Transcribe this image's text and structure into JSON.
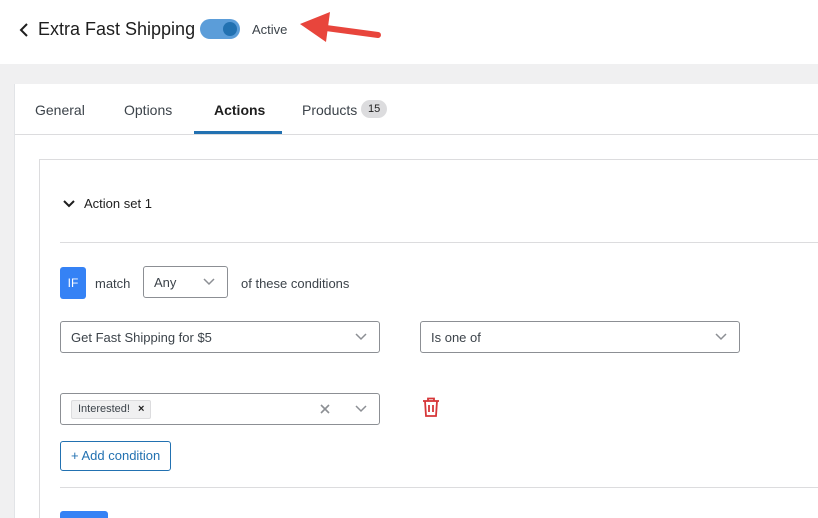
{
  "header": {
    "title": "Extra Fast Shipping",
    "status_label": "Active",
    "toggle_on": true
  },
  "tabs": [
    {
      "label": "General"
    },
    {
      "label": "Options"
    },
    {
      "label": "Actions",
      "active": true
    },
    {
      "label": "Products",
      "badge": "15"
    }
  ],
  "action_set": {
    "label": "Action set 1",
    "if_label": "IF",
    "match_label": "match",
    "match_value": "Any",
    "conditions_label": "of these conditions",
    "condition": {
      "field": "Get Fast Shipping for $5",
      "operator": "Is one of",
      "values": [
        "Interested!"
      ],
      "remove_tag_glyph": "×"
    },
    "add_condition_label": "+ Add condition"
  },
  "colors": {
    "accent": "#2271b1",
    "if_badge": "#3582f5",
    "toggle_track": "#5b9dd9",
    "trash": "#d63638",
    "arrow": "#e8453c"
  },
  "icons": [
    "back-chevron-icon",
    "arrow-pointer-icon",
    "chevron-down-icon",
    "clear-icon",
    "trash-icon"
  ]
}
